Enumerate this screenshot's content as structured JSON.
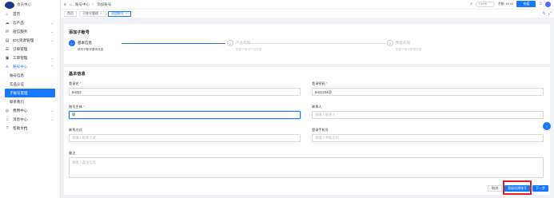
{
  "brand": {
    "name": "会员中心"
  },
  "sidebar": {
    "items": [
      {
        "label": "首页",
        "icon": "home-icon",
        "glyph": "⌂",
        "chevron": ""
      },
      {
        "label": "云产品",
        "icon": "cloud-icon",
        "glyph": "☁",
        "chevron": "⌄"
      },
      {
        "label": "短信服务",
        "icon": "message-icon",
        "glyph": "✉",
        "chevron": "⌄"
      },
      {
        "label": "IDC资源管理",
        "icon": "server-icon",
        "glyph": "▤",
        "chevron": "⌄"
      },
      {
        "label": "订单管理",
        "icon": "order-icon",
        "glyph": "☰",
        "chevron": ""
      },
      {
        "label": "工单管理",
        "icon": "ticket-icon",
        "glyph": "▣",
        "chevron": "⌄"
      },
      {
        "label": "账号中心",
        "icon": "user-icon",
        "glyph": "♙",
        "chevron": "⌃"
      }
    ],
    "sub_items": [
      {
        "label": "账号信息"
      },
      {
        "label": "实名认证"
      },
      {
        "label": "子账号管理"
      },
      {
        "label": "联系我们"
      }
    ],
    "bottom_items": [
      {
        "label": "费用中心",
        "icon": "wallet-icon",
        "glyph": "◎",
        "chevron": "⌄"
      },
      {
        "label": "消息中心",
        "icon": "bell-icon",
        "glyph": "♫",
        "chevron": "⌄"
      },
      {
        "label": "帮助文档",
        "icon": "help-icon",
        "glyph": "?",
        "chevron": ""
      }
    ]
  },
  "topbar": {
    "breadcrumb": [
      "账号中心",
      "/",
      "添加账号"
    ],
    "search_placeholder": "Ctrl+K",
    "balance": "余额: ¥0.00",
    "recharge": "充值"
  },
  "tabs": [
    {
      "label": "首页"
    },
    {
      "label": "子账号管理"
    },
    {
      "label": "添加账号"
    }
  ],
  "steps_card": {
    "title": "添加子账号",
    "steps": [
      {
        "num": "1",
        "title": "基本信息",
        "desc": "填写子账号基本信息"
      },
      {
        "num": "2",
        "title": "产品权限",
        "desc": "配置子账号产品权限"
      },
      {
        "num": "3",
        "title": "数据权限",
        "desc": "配置子账号数据权限"
      }
    ]
  },
  "form": {
    "title": "基本信息",
    "login_name": {
      "label": "登录名",
      "value": "test12"
    },
    "password": {
      "label": "登录密码",
      "value": "test1234@"
    },
    "account_holder": {
      "label": "账号主体",
      "value": "梁"
    },
    "contact_person": {
      "label": "联系人",
      "placeholder": "请输入联系人"
    },
    "contact_method": {
      "label": "联系方式",
      "placeholder": "请输入联系方式"
    },
    "email": {
      "label": "登录手机号",
      "placeholder": "请输入手机号码"
    },
    "remark": {
      "label": "备注",
      "placeholder": "请输入备注信息"
    },
    "cancel": "取消",
    "save_and_create": "直接创建账号",
    "next": "下一步"
  },
  "float_help": "?"
}
